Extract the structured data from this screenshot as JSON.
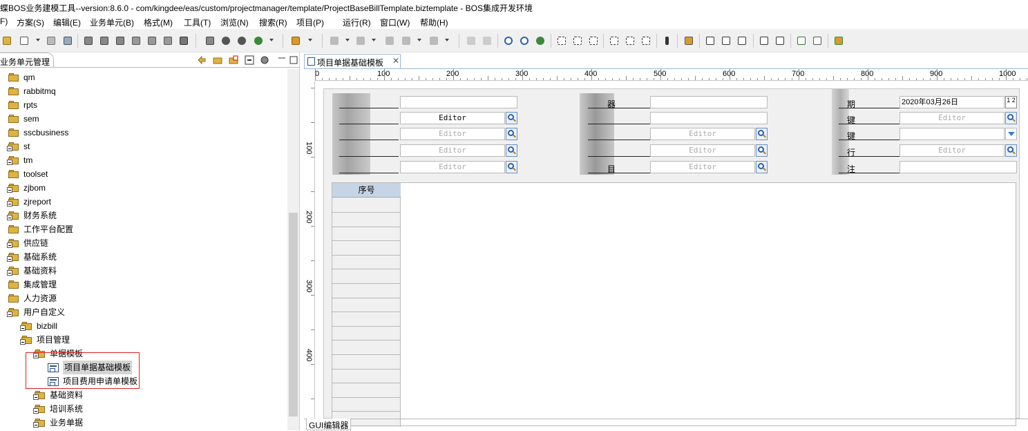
{
  "window": {
    "title": "蝶BOS业务建模工具--version:8.6.0  -  com/kingdee/eas/custom/projectmanager/template/ProjectBaseBillTemplate.biztemplate  -  BOS集成开发环境"
  },
  "menu": [
    "F)",
    "方案(S)",
    "编辑(E)",
    "业务单元(B)",
    "格式(M)",
    "工具(T)",
    "浏览(N)",
    "搜索(R)",
    "项目(P)",
    "运行(R)",
    "窗口(W)",
    "帮助(H)"
  ],
  "left_view": {
    "title": "业务单元管理",
    "tree": [
      {
        "label": "qm",
        "level": 0,
        "type": "folder"
      },
      {
        "label": "rabbitmq",
        "level": 0,
        "type": "folder"
      },
      {
        "label": "rpts",
        "level": 0,
        "type": "folder"
      },
      {
        "label": "sem",
        "level": 0,
        "type": "folder"
      },
      {
        "label": "sscbusiness",
        "level": 0,
        "type": "folder"
      },
      {
        "label": "st",
        "level": 0,
        "type": "package"
      },
      {
        "label": "tm",
        "level": 0,
        "type": "package"
      },
      {
        "label": "toolset",
        "level": 0,
        "type": "folder"
      },
      {
        "label": "zjbom",
        "level": 0,
        "type": "package"
      },
      {
        "label": "zjreport",
        "level": 0,
        "type": "package"
      },
      {
        "label": "财务系统",
        "level": 0,
        "type": "package"
      },
      {
        "label": "工作平台配置",
        "level": 0,
        "type": "folder"
      },
      {
        "label": "供应链",
        "level": 0,
        "type": "package"
      },
      {
        "label": "基础系统",
        "level": 0,
        "type": "package"
      },
      {
        "label": "基础资料",
        "level": 0,
        "type": "package"
      },
      {
        "label": "集成管理",
        "level": 0,
        "type": "folder"
      },
      {
        "label": "人力资源",
        "level": 0,
        "type": "folder"
      },
      {
        "label": "用户自定义",
        "level": 0,
        "type": "package"
      },
      {
        "label": "bizbill",
        "level": 1,
        "type": "package"
      },
      {
        "label": "项目管理",
        "level": 1,
        "type": "package"
      },
      {
        "label": "单据模板",
        "level": 2,
        "type": "package"
      },
      {
        "label": "项目单据基础模板",
        "level": 3,
        "type": "template",
        "selected": true
      },
      {
        "label": "项目费用申请单模板",
        "level": 3,
        "type": "template"
      },
      {
        "label": "基础资料",
        "level": 2,
        "type": "package"
      },
      {
        "label": "培训系统",
        "level": 2,
        "type": "package"
      },
      {
        "label": "业务单据",
        "level": 2,
        "type": "package"
      }
    ]
  },
  "editor": {
    "tab_title": "项目单据基础模板",
    "ruler_labels": [
      "0",
      "100",
      "200",
      "300",
      "400",
      "500",
      "600",
      "700",
      "800",
      "900",
      "1000"
    ],
    "vruler_labels": [
      "100",
      "200",
      "300",
      "400"
    ],
    "fields": {
      "col1": [
        "",
        "Editor",
        "Editor",
        "Editor",
        "Editor"
      ],
      "col2": [
        "",
        "",
        "Editor",
        "Editor",
        "Editor"
      ],
      "col3": [
        "2020年03月26日",
        "Editor",
        "",
        "Editor",
        ""
      ]
    },
    "label_fragments": {
      "col2": [
        "器",
        "",
        "",
        "",
        "目"
      ],
      "col3": [
        "期",
        "键",
        "键",
        "行",
        "注"
      ]
    },
    "grid_header": "序号",
    "bottom_tab": "GUI编辑器",
    "calendar_glyph": "1 2"
  }
}
